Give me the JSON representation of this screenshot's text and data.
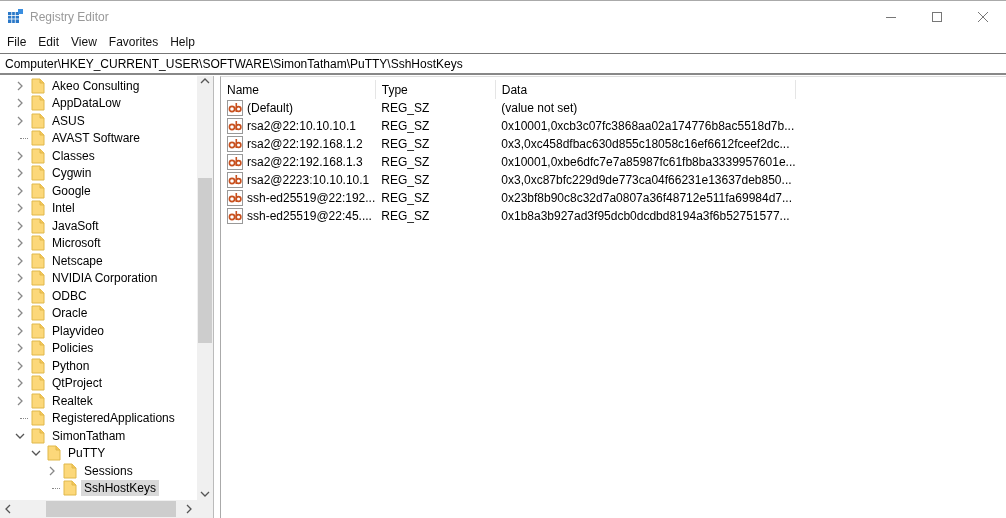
{
  "window": {
    "title": "Registry Editor"
  },
  "menu": [
    "File",
    "Edit",
    "View",
    "Favorites",
    "Help"
  ],
  "address": {
    "value": "Computer\\HKEY_CURRENT_USER\\SOFTWARE\\SimonTatham\\PuTTY\\SshHostKeys"
  },
  "tree": {
    "items": [
      {
        "label": "Akeo Consulting",
        "expanded": false,
        "selected": false
      },
      {
        "label": "AppDataLow",
        "expanded": false,
        "selected": false
      },
      {
        "label": "ASUS",
        "expanded": false,
        "selected": false
      },
      {
        "label": "AVAST Software",
        "selected": false
      },
      {
        "label": "Classes",
        "expanded": false,
        "selected": false
      },
      {
        "label": "Cygwin",
        "expanded": false,
        "selected": false
      },
      {
        "label": "Google",
        "expanded": false,
        "selected": false
      },
      {
        "label": "Intel",
        "expanded": false,
        "selected": false
      },
      {
        "label": "JavaSoft",
        "expanded": false,
        "selected": false
      },
      {
        "label": "Microsoft",
        "expanded": false,
        "selected": false
      },
      {
        "label": "Netscape",
        "expanded": false,
        "selected": false
      },
      {
        "label": "NVIDIA Corporation",
        "expanded": false,
        "selected": false
      },
      {
        "label": "ODBC",
        "expanded": false,
        "selected": false
      },
      {
        "label": "Oracle",
        "expanded": false,
        "selected": false
      },
      {
        "label": "Playvideo",
        "expanded": false,
        "selected": false
      },
      {
        "label": "Policies",
        "expanded": false,
        "selected": false
      },
      {
        "label": "Python",
        "expanded": false,
        "selected": false
      },
      {
        "label": "QtProject",
        "expanded": false,
        "selected": false
      },
      {
        "label": "Realtek",
        "expanded": false,
        "selected": false
      },
      {
        "label": "RegisteredApplications",
        "selected": false
      },
      {
        "label": "SimonTatham",
        "expanded": true,
        "selected": false,
        "children": [
          {
            "label": "PuTTY",
            "expanded": true,
            "selected": false,
            "children": [
              {
                "label": "Sessions",
                "expanded": false,
                "selected": false
              },
              {
                "label": "SshHostKeys",
                "selected": true
              }
            ]
          }
        ]
      }
    ]
  },
  "list": {
    "columns": [
      "Name",
      "Type",
      "Data"
    ],
    "rows": [
      {
        "name": "(Default)",
        "type": "REG_SZ",
        "data": "(value not set)"
      },
      {
        "name": "rsa2@22:10.10.10.1",
        "type": "REG_SZ",
        "data": "0x10001,0xcb3c07fc3868aa02a174776b8ac5518d7b..."
      },
      {
        "name": "rsa2@22:192.168.1.2",
        "type": "REG_SZ",
        "data": "0x3,0xc458dfbac630d855c18058c16ef6612fceef2dc..."
      },
      {
        "name": "rsa2@22:192.168.1.3",
        "type": "REG_SZ",
        "data": "0x10001,0xbe6dfc7e7a85987fc61fb8ba3339957601e..."
      },
      {
        "name": "rsa2@2223:10.10.10.1",
        "type": "REG_SZ",
        "data": "0x3,0xc87bfc229d9de773ca04f66231e13637deb850..."
      },
      {
        "name": "ssh-ed25519@22:192...",
        "type": "REG_SZ",
        "data": "0x23bf8b90c8c32d7a0807a36f48712e511fa69984d7..."
      },
      {
        "name": "ssh-ed25519@22:45....",
        "type": "REG_SZ",
        "data": "0x1b8a3b927ad3f95dcb0dcdbd8194a3f6b52751577..."
      }
    ]
  }
}
